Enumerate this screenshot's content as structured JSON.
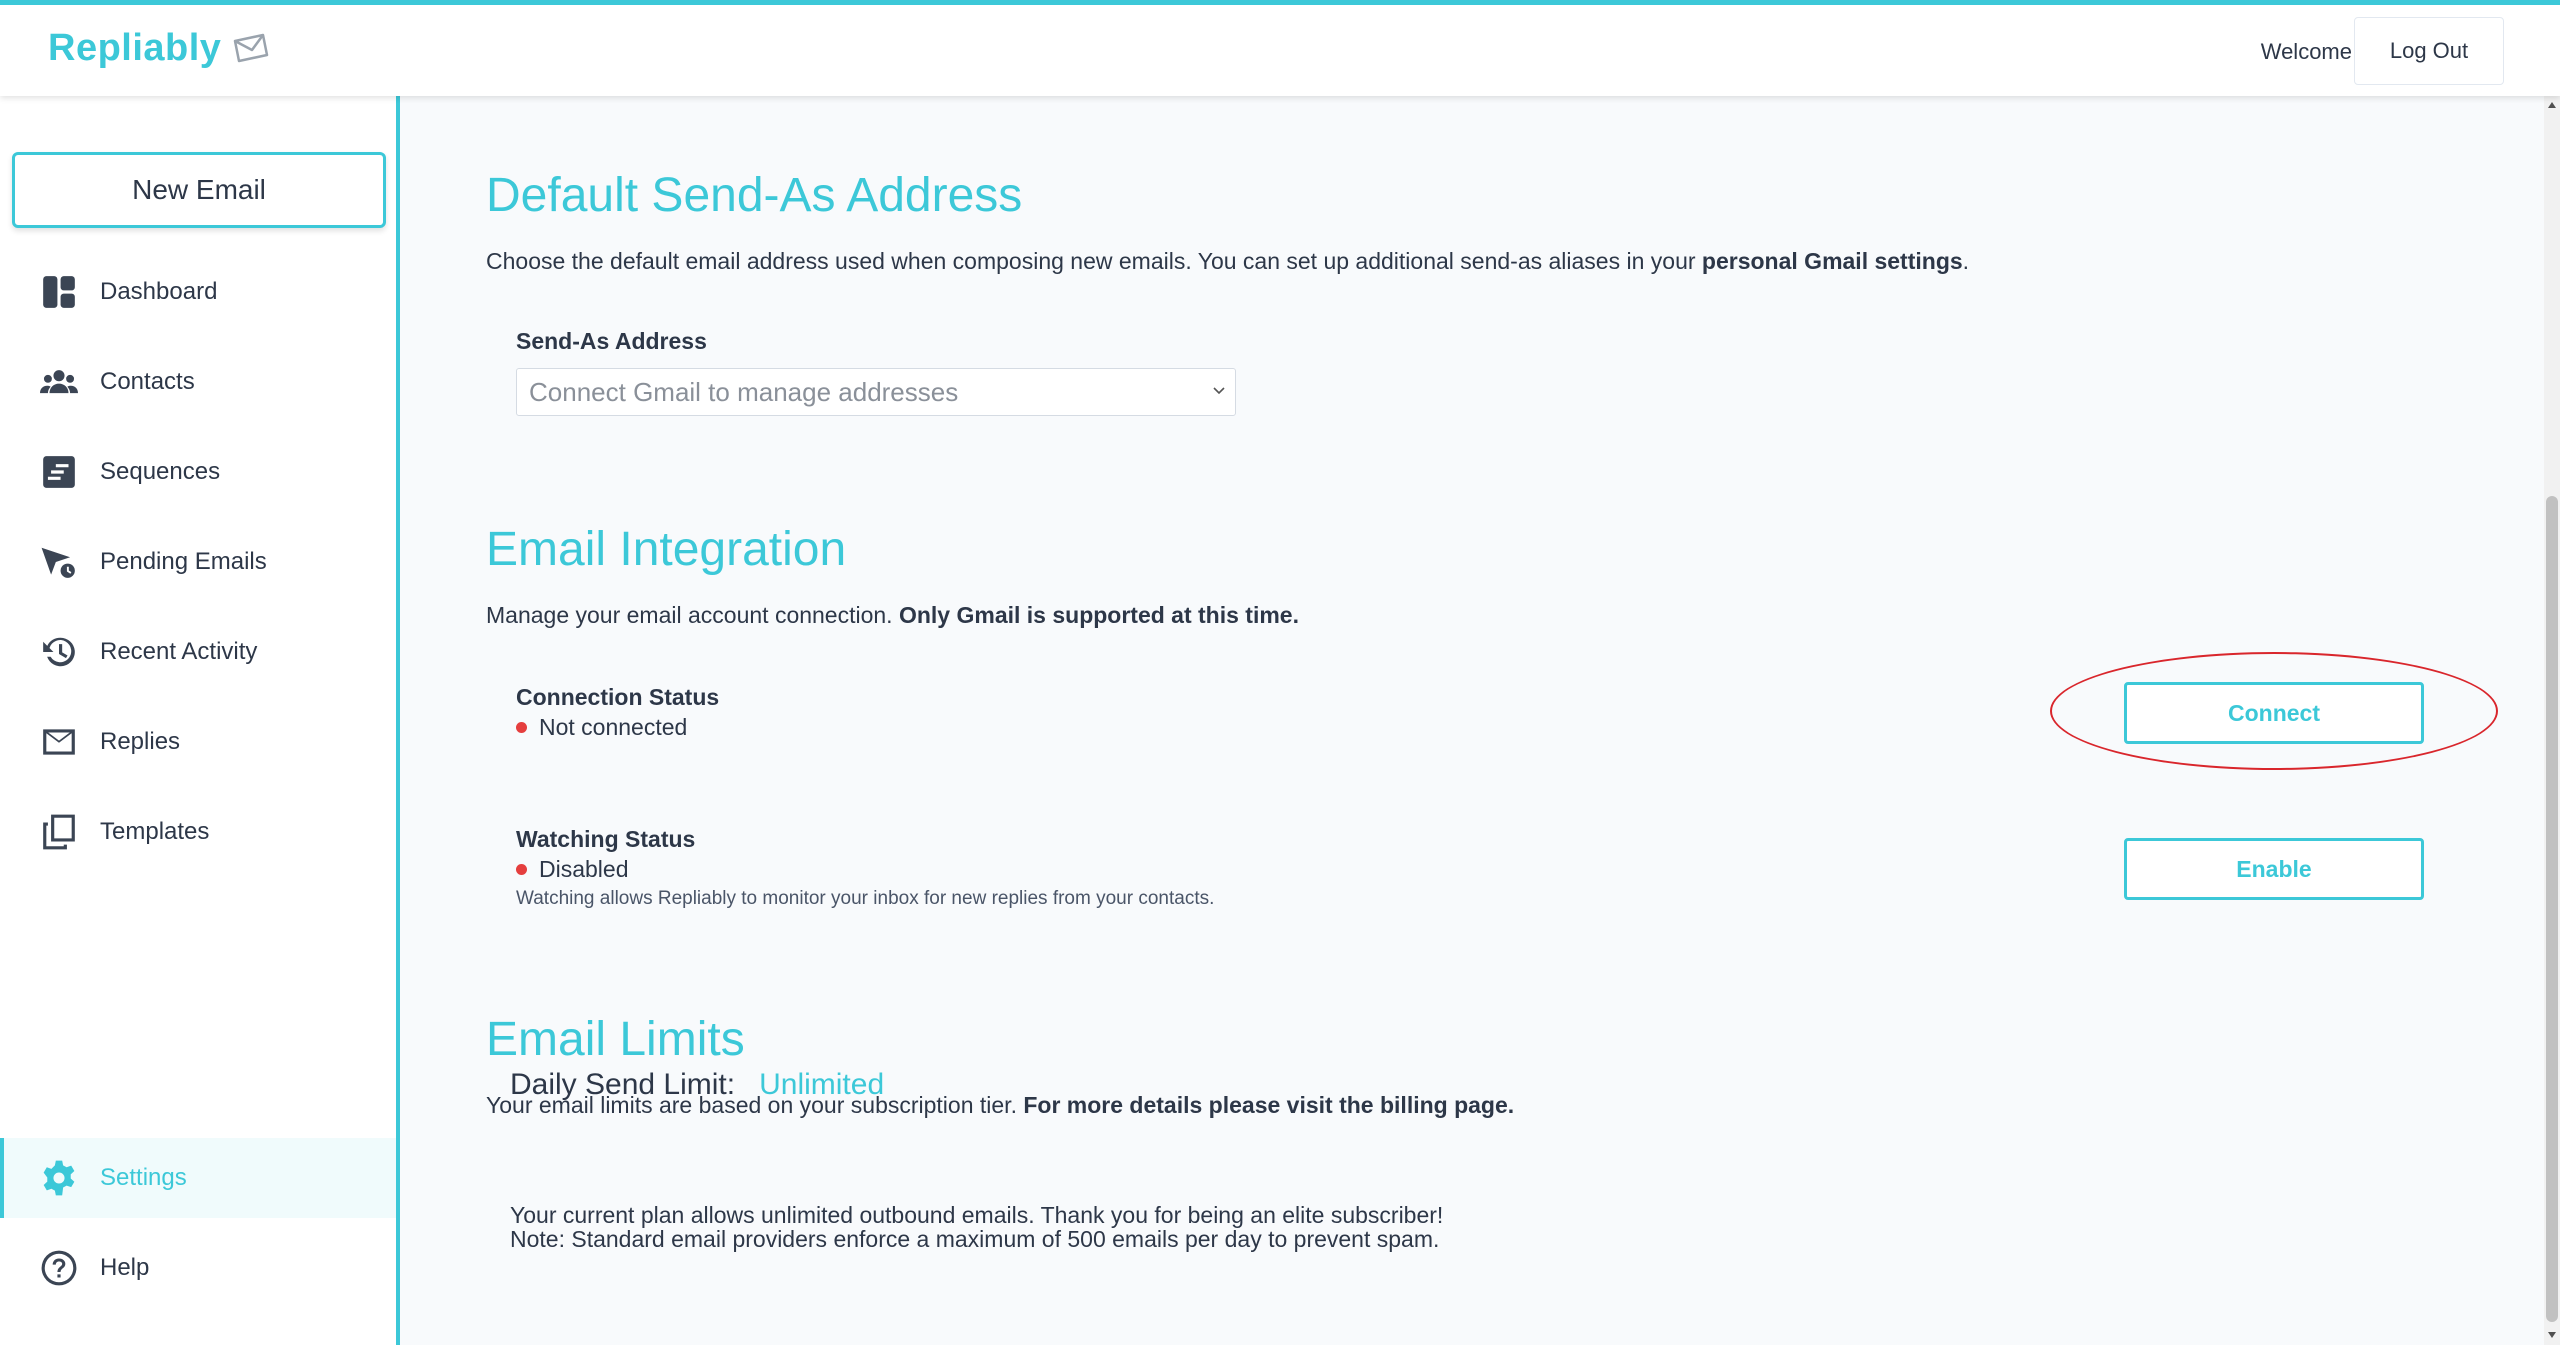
{
  "brand": {
    "name": "Repliably",
    "color": "#3cc8d8"
  },
  "header": {
    "welcome": "Welcome",
    "logout": "Log Out"
  },
  "sidebar": {
    "new_email": "New Email",
    "items": [
      {
        "label": "Dashboard",
        "icon": "dashboard-icon"
      },
      {
        "label": "Contacts",
        "icon": "users-icon"
      },
      {
        "label": "Sequences",
        "icon": "sequence-icon"
      },
      {
        "label": "Pending Emails",
        "icon": "pending-email-icon"
      },
      {
        "label": "Recent Activity",
        "icon": "history-icon"
      },
      {
        "label": "Replies",
        "icon": "envelope-icon"
      },
      {
        "label": "Templates",
        "icon": "copy-icon"
      }
    ],
    "bottom": [
      {
        "label": "Settings",
        "icon": "gear-icon",
        "active": true
      },
      {
        "label": "Help",
        "icon": "question-icon"
      }
    ]
  },
  "sendas": {
    "title": "Default Send-As Address",
    "desc_pre": "Choose the default email address used when composing new emails. You can set up additional send-as aliases in your ",
    "desc_bold": "personal Gmail settings",
    "desc_post": ".",
    "field_label": "Send-As Address",
    "placeholder": "Connect Gmail to manage addresses"
  },
  "integration": {
    "title": "Email Integration",
    "desc_pre": "Manage your email account connection. ",
    "desc_bold": "Only Gmail is supported at this time.",
    "connection_label": "Connection Status",
    "connection_value": "Not connected",
    "connect_button": "Connect",
    "watching_label": "Watching Status",
    "watching_value": "Disabled",
    "watching_note": "Watching allows Repliably to monitor your inbox for new replies from your contacts.",
    "enable_button": "Enable",
    "status_color": "#e53e3e"
  },
  "limits": {
    "title": "Email Limits",
    "desc_pre": "Your email limits are based on your subscription tier. ",
    "desc_bold": "For more details please visit the billing page.",
    "daily_label": "Daily Send Limit:",
    "daily_value": "Unlimited",
    "note1": "Your current plan allows unlimited outbound emails. Thank you for being an elite subscriber!",
    "note2": "Note: Standard email providers enforce a maximum of 500 emails per day to prevent spam."
  }
}
